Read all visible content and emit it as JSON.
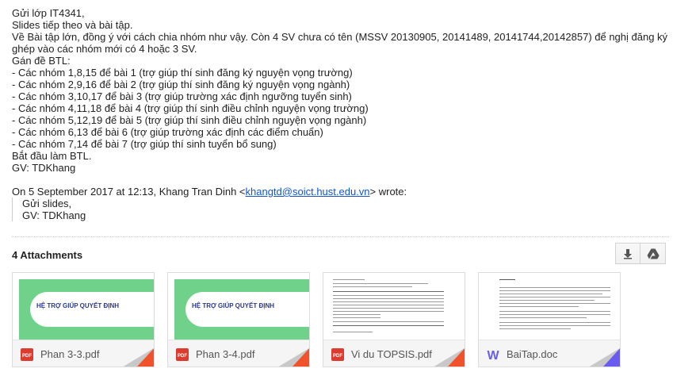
{
  "email": {
    "lines": [
      "Gửi lớp IT4341,",
      "Slides tiếp theo và bài tập.",
      "Về Bài tập lớn, đồng ý với cách chia nhóm như vậy. Còn 4 SV chưa có tên (MSSV 20130905, 20141489, 20141744,20142857) để nghị đăng ký ghép vào các nhóm mới có 4 hoặc 3 SV.",
      "Gán đề BTL:",
      "- Các nhóm 1,8,15 để bài 1 (trợ giúp thí sinh đăng ký nguyện vọng trường)",
      "- Các nhóm 2,9,16 để bài 2 (trợ giúp thí sinh đăng ký nguyện vọng ngành)",
      "- Các nhóm 3,10,17 để bài 3 (trợ giúp trường xác định ngưỡng tuyển sinh)",
      "- Các nhóm 4,11,18 để bài 4 (trợ giúp thí sinh điều chỉnh nguyện vọng trường)",
      "- Các nhóm 5,12,19 để bài 5 (trợ giúp thí sinh điều chỉnh nguyện vọng ngành)",
      "- Các nhóm 6,13 để bài 6 (trợ giúp trường xác định các điểm chuẩn)",
      "- Các nhóm 7,14 để bài 7 (trợ giúp thí sinh tuyển bổ sung)",
      "Bắt đầu làm BTL.",
      "GV: TDKhang"
    ],
    "quote_intro": "On 5 September 2017 at 12:13, Khang Tran Dinh <",
    "quote_email": "khangtd@soict.hust.edu.vn",
    "quote_outro": "> wrote:",
    "quote_lines": [
      "Gửi slides,",
      "GV: TDKhang"
    ]
  },
  "attachments": {
    "header": "4 Attachments",
    "actions": [
      {
        "name": "download-all-icon"
      },
      {
        "name": "save-to-drive-icon"
      }
    ],
    "items": [
      {
        "filename": "Phan 3-3.pdf",
        "type": "pdf",
        "badge": "PDF",
        "icon": "pdf-icon",
        "accent": "#f0522c",
        "thumb_title": "HỆ TRỢ GIÚP QUYẾT ĐỊNH"
      },
      {
        "filename": "Phan 3-4.pdf",
        "type": "pdf",
        "badge": "PDF",
        "icon": "pdf-icon",
        "accent": "#f0522c",
        "thumb_title": "HỆ TRỢ GIÚP QUYẾT ĐỊNH"
      },
      {
        "filename": "Vi du TOPSIS.pdf",
        "type": "pdf",
        "badge": "PDF",
        "icon": "pdf-icon",
        "accent": "#f0522c"
      },
      {
        "filename": "BaiTap.doc",
        "type": "doc",
        "badge": "W",
        "icon": "word-icon",
        "accent": "#6a5cf0"
      }
    ]
  },
  "colors": {
    "link": "#1155cc",
    "pdf": "#dc3b2f",
    "word": "#6a5cf0"
  }
}
